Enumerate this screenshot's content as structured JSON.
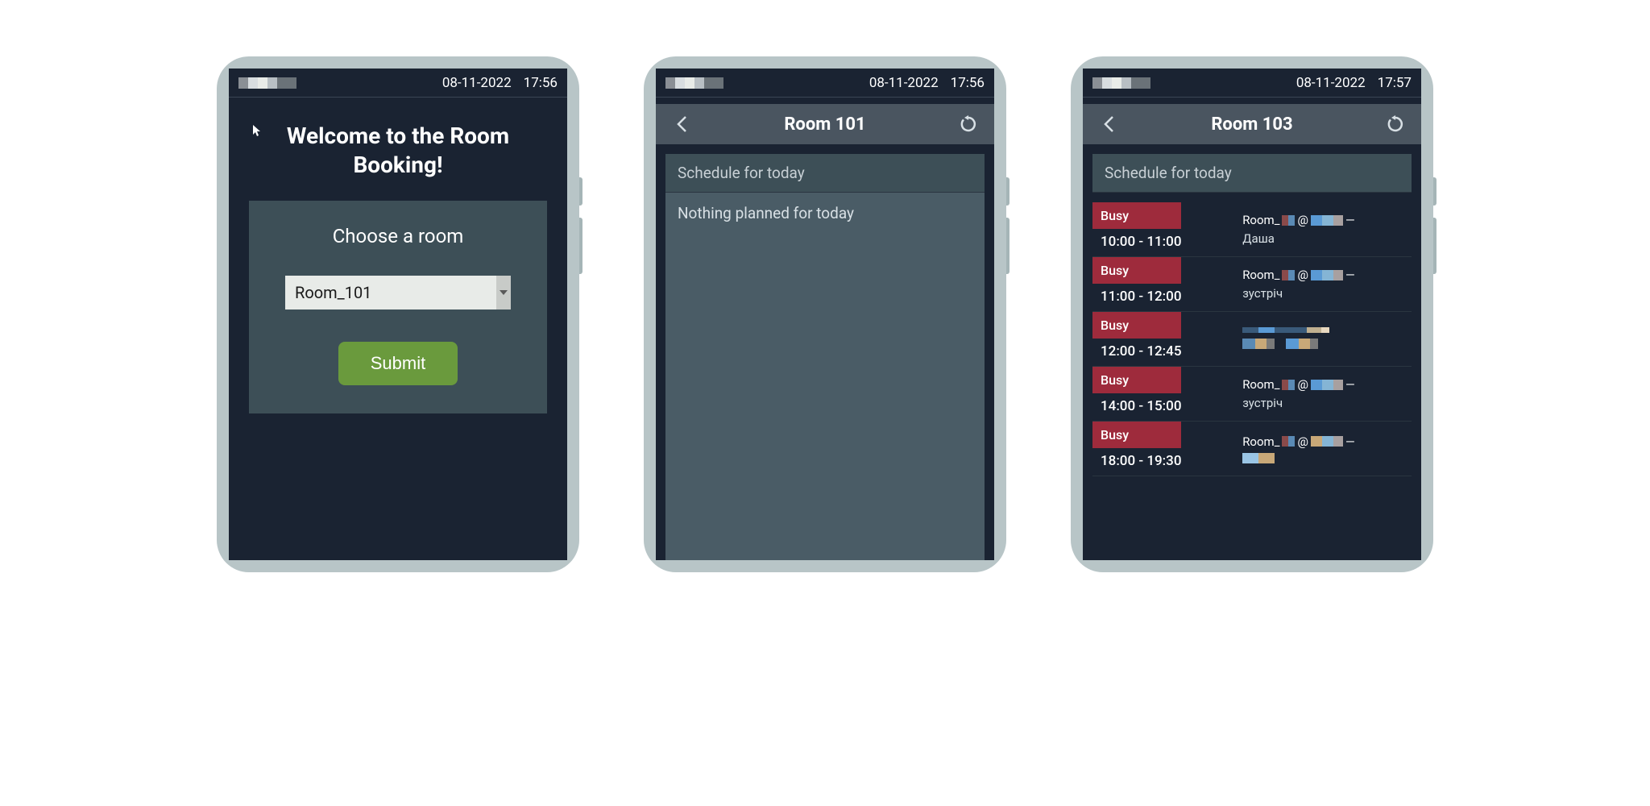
{
  "status": {
    "date": "08-11-2022",
    "time1": "17:56",
    "time2": "17:56",
    "time3": "17:57"
  },
  "welcome": {
    "title": "Welcome to the Room Booking!",
    "choose_label": "Choose a room",
    "selected_room": "Room_101",
    "submit_label": "Submit"
  },
  "room101": {
    "title": "Room 101",
    "schedule_header": "Schedule for today",
    "nothing": "Nothing planned for today"
  },
  "room103": {
    "title": "Room 103",
    "schedule_header": "Schedule for today",
    "bookings": [
      {
        "status": "Busy",
        "time": "10:00 - 11:00",
        "line1_prefix": "Room_",
        "line1_mid": " @",
        "line2": "Даша"
      },
      {
        "status": "Busy",
        "time": "11:00 - 12:00",
        "line1_prefix": "Room_",
        "line1_mid": "@",
        "line2": "зустріч"
      },
      {
        "status": "Busy",
        "time": "12:00 - 12:45",
        "line1_prefix": "",
        "line1_mid": "",
        "line2": ""
      },
      {
        "status": "Busy",
        "time": "14:00 - 15:00",
        "line1_prefix": "Room_",
        "line1_mid": " @",
        "line2": "зустріч"
      },
      {
        "status": "Busy",
        "time": "18:00 - 19:30",
        "line1_prefix": "Room_",
        "line1_mid": " @",
        "line2": ""
      }
    ]
  }
}
